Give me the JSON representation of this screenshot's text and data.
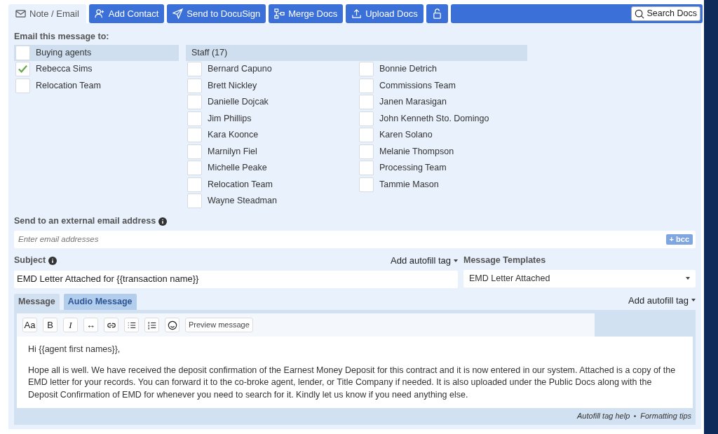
{
  "tabs": [
    {
      "label": "Note / Email",
      "selected": true
    }
  ],
  "toolbar_buttons": [
    {
      "label": "Add Contact",
      "kind": "contact"
    },
    {
      "label": "Send to DocuSign",
      "kind": "send"
    },
    {
      "label": "Merge Docs",
      "kind": "merge"
    },
    {
      "label": "Upload Docs",
      "kind": "upload"
    },
    {
      "kind": "lock"
    }
  ],
  "search": {
    "label": "Search Docs"
  },
  "recipients": {
    "heading": "Email this message to:",
    "groups": [
      {
        "label": "Buying agents",
        "checked": false,
        "members": [
          {
            "name": "Rebecca Sims",
            "checked": true
          },
          {
            "name": "Relocation Team",
            "checked": false
          }
        ]
      },
      {
        "label": "Staff (17)",
        "members": [
          {
            "name": "Bernard Capuno",
            "checked": false
          },
          {
            "name": "Brett Nickley",
            "checked": false
          },
          {
            "name": "Danielle Dojcak",
            "checked": false
          },
          {
            "name": "Jim Phillips",
            "checked": false
          },
          {
            "name": "Kara Koonce",
            "checked": false
          },
          {
            "name": "Marnilyn Fiel",
            "checked": false
          },
          {
            "name": "Michelle Peake",
            "checked": false
          },
          {
            "name": "Relocation Team",
            "checked": false
          },
          {
            "name": "Wayne Steadman",
            "checked": false
          },
          {
            "name": "Bonnie Detrich",
            "checked": false
          },
          {
            "name": "Commissions Team",
            "checked": false
          },
          {
            "name": "Janen Marasigan",
            "checked": false
          },
          {
            "name": "John Kenneth Sto. Domingo",
            "checked": false
          },
          {
            "name": "Karen Solano",
            "checked": false
          },
          {
            "name": "Melanie Thompson",
            "checked": false
          },
          {
            "name": "Processing Team",
            "checked": false
          },
          {
            "name": "Tammie Mason",
            "checked": false
          }
        ]
      }
    ]
  },
  "external": {
    "label": "Send to an external email address",
    "placeholder": "Enter email addresses",
    "bcc_button": "+ bcc"
  },
  "subject": {
    "label": "Subject",
    "value": "EMD Letter Attached for {{transaction name}}",
    "autofill": "Add autofill tag"
  },
  "templates": {
    "label": "Message Templates",
    "value": "EMD Letter Attached"
  },
  "message_tabs": [
    {
      "label": "Message",
      "selected": true
    },
    {
      "label": "Audio Message",
      "selected": false
    }
  ],
  "message_autofill": "Add autofill tag",
  "editor_tools": [
    {
      "kind": "text",
      "label": "Aa"
    },
    {
      "kind": "text",
      "label": "B"
    },
    {
      "kind": "italic",
      "label": "I"
    },
    {
      "kind": "text",
      "label": "↔"
    },
    {
      "kind": "link"
    },
    {
      "kind": "bullets"
    },
    {
      "kind": "numbers"
    },
    {
      "kind": "emoji"
    },
    {
      "kind": "preview",
      "label": "Preview message"
    }
  ],
  "body": [
    "Hi {{agent first names}},",
    "Hope all is well. We have received the deposit confirmation of the Earnest Money Deposit for this contract and it is now entered in our system. Attached is a copy of the EMD letter for your records. You can forward it to the co-broke agent, lender, or Title Company if needed. It is also uploaded under the Public Docs along with the Deposit Confirmation of EMD for whenever you need to search for it. Kindly let us know if you need anything else."
  ],
  "footer_links": [
    "Autofill tag help",
    "Formatting tips"
  ]
}
